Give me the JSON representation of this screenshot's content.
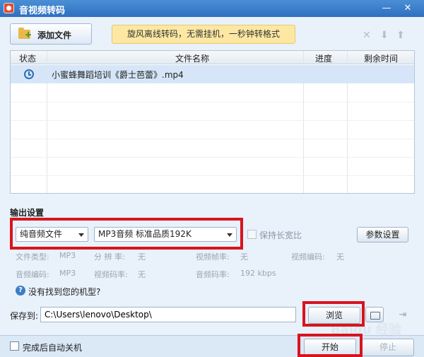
{
  "window": {
    "title": "音视频转码",
    "minimize_glyph": "—",
    "close_glyph": "✕"
  },
  "toolbar": {
    "add_file_label": "添加文件",
    "promo_text": "旋风离线转码，无需挂机，一秒钟转格式",
    "delete_glyph": "✕",
    "down_glyph": "⬇",
    "up_glyph": "⬆"
  },
  "file_table": {
    "columns": [
      "状态",
      "文件名称",
      "进度",
      "剩余时间"
    ],
    "rows": [
      {
        "status_icon": "clock-icon",
        "name": "小蜜蜂舞蹈培训《爵士芭蕾》.mp4",
        "progress": "",
        "remaining": ""
      }
    ]
  },
  "output": {
    "section_title": "输出设置",
    "type_select": "纯音频文件",
    "format_select": "MP3音频 标准品质192K",
    "keep_ratio_label": "保持长宽比",
    "params_button": "参数设置",
    "info": {
      "file_type_label": "文件类型:",
      "file_type_value": "MP3",
      "resolution_label": "分 辨 率:",
      "resolution_value": "无",
      "video_fps_label": "视频帧率:",
      "video_fps_value": "无",
      "video_codec_label": "视频编码:",
      "video_codec_value": "无",
      "audio_codec_label": "音频编码:",
      "audio_codec_value": "MP3",
      "video_bitrate_label": "视频码率:",
      "video_bitrate_value": "无",
      "audio_bitrate_label": "音频码率:",
      "audio_bitrate_value": "192 kbps"
    },
    "help_text": "没有找到您的机型?"
  },
  "save": {
    "label": "保存到:",
    "path": "C:\\Users\\lenovo\\Desktop\\",
    "browse_button": "浏览"
  },
  "bottom": {
    "auto_shutdown_label": "完成后自动关机",
    "start_button": "开始",
    "stop_button": "停止"
  },
  "watermark_text": "Baidu 经验",
  "colors": {
    "titlebar": "#2f6fbf",
    "highlight": "#d8141d",
    "promo_bg": "#fde8a3",
    "selected_row": "#d6e6f8"
  }
}
